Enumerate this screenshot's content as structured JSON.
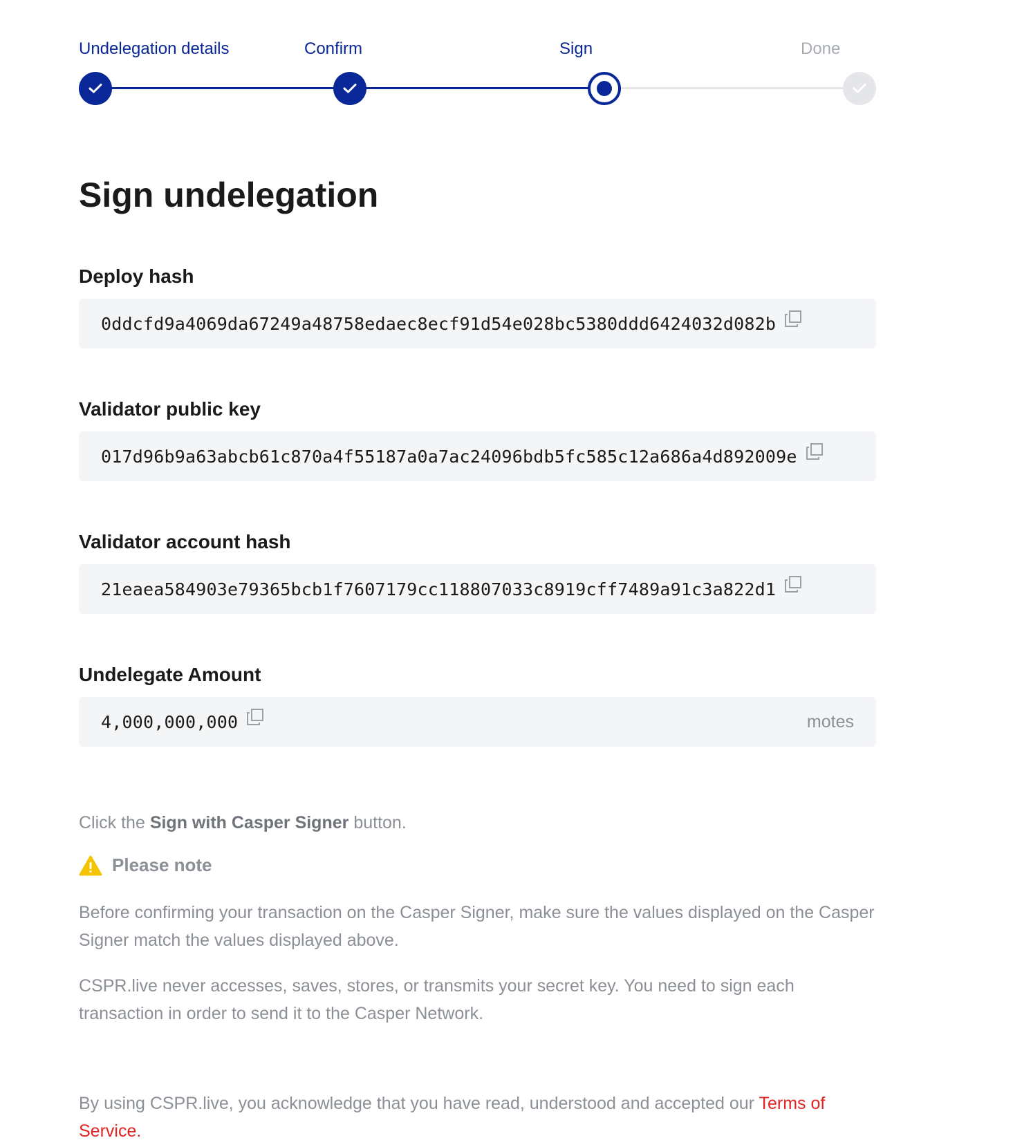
{
  "stepper": {
    "steps": [
      {
        "label": "Undelegation details",
        "state": "done"
      },
      {
        "label": "Confirm",
        "state": "done"
      },
      {
        "label": "Sign",
        "state": "current"
      },
      {
        "label": "Done",
        "state": "pending"
      }
    ]
  },
  "page": {
    "title": "Sign undelegation"
  },
  "fields": {
    "deploy_hash": {
      "label": "Deploy hash",
      "value": "0ddcfd9a4069da67249a48758edaec8ecf91d54e028bc5380ddd6424032d082b"
    },
    "validator_public_key": {
      "label": "Validator public key",
      "value": "017d96b9a63abcb61c870a4f55187a0a7ac24096bdb5fc585c12a686a4d892009e"
    },
    "validator_account_hash": {
      "label": "Validator account hash",
      "value": "21eaea584903e79365bcb1f7607179cc118807033c8919cff7489a91c3a822d1"
    },
    "undelegate_amount": {
      "label": "Undelegate Amount",
      "value": "4,000,000,000",
      "unit": "motes"
    }
  },
  "instructions": {
    "prefix": "Click the ",
    "button_name": "Sign with Casper Signer",
    "suffix": " button."
  },
  "note": {
    "heading": "Please note",
    "paragraph_1": "Before confirming your transaction on the Casper Signer, make sure the values displayed on the Casper Signer match the values displayed above.",
    "paragraph_2": "CSPR.live never accesses, saves, stores, or transmits your secret key. You need to sign each transaction in order to send it to the Casper Network."
  },
  "footer": {
    "text": "By using CSPR.live, you acknowledge that you have read, understood and accepted our ",
    "link": "Terms of Service."
  },
  "colors": {
    "accent": "#0a2797",
    "pending": "#e4e6ea",
    "warning": "#f5c400",
    "link": "#e02424"
  }
}
